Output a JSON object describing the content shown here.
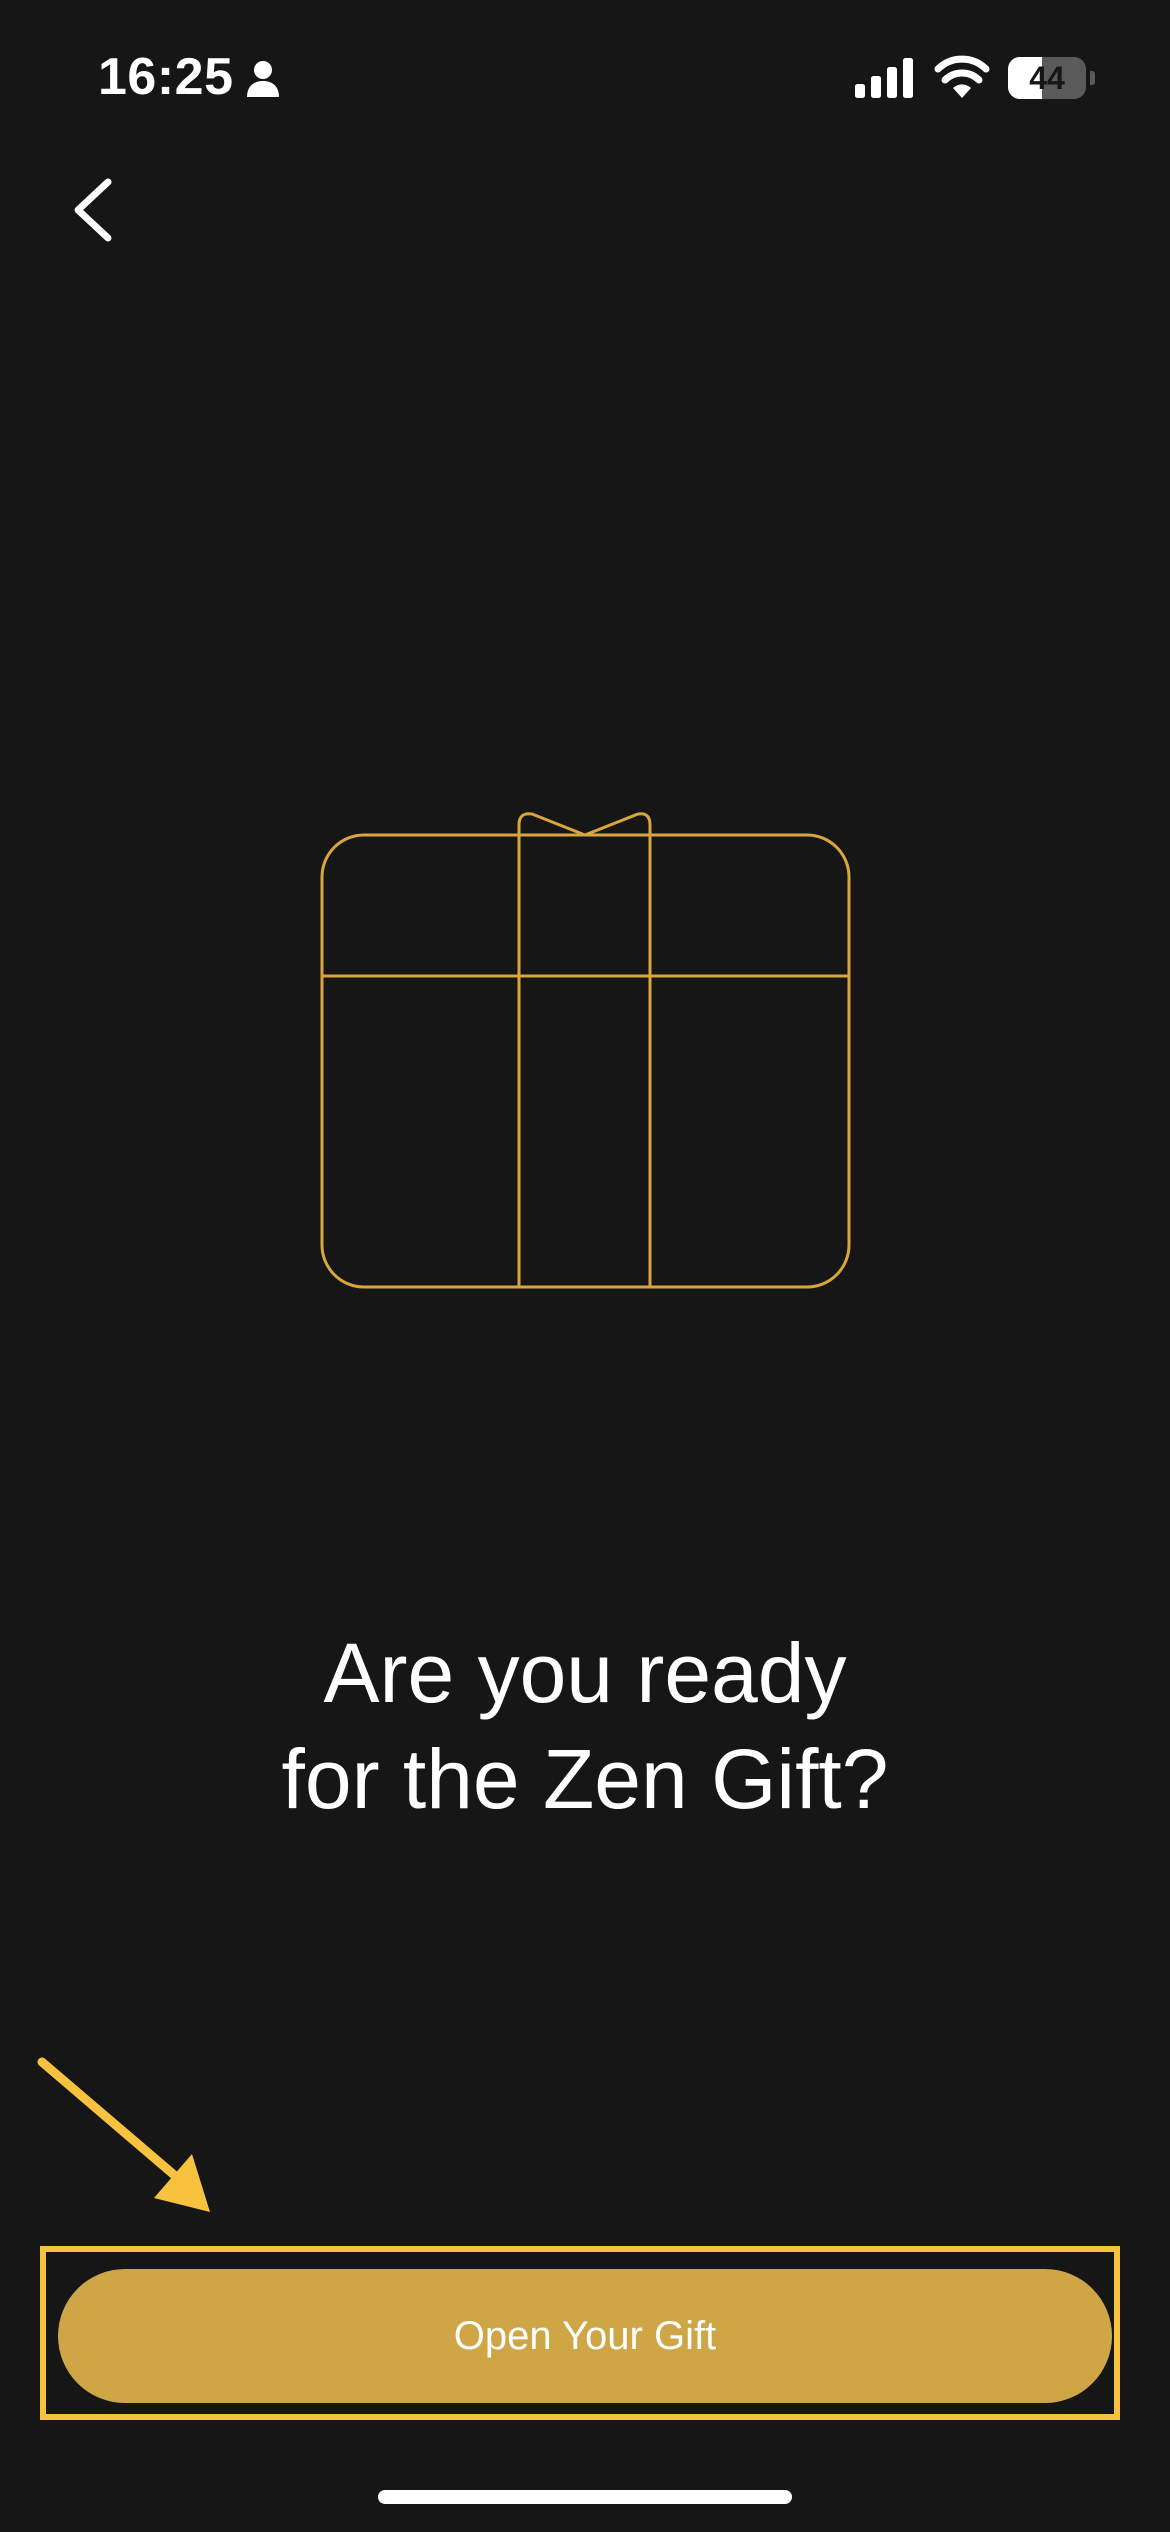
{
  "status_bar": {
    "time": "16:25",
    "battery_level": "44",
    "battery_fraction": 0.44,
    "icons": [
      "person-icon",
      "signal-icon",
      "wifi-icon",
      "battery-icon"
    ]
  },
  "nav": {
    "back_icon": "chevron-left-icon"
  },
  "illustration": {
    "icon": "gift-icon",
    "stroke_color": "#d8a63d"
  },
  "headline": {
    "line1": "Are you ready",
    "line2": "for the Zen Gift?"
  },
  "cta": {
    "label": "Open Your Gift",
    "background_color": "#cea646",
    "highlight_color": "#f7c33f"
  },
  "colors": {
    "background": "#161616",
    "text": "#ffffff"
  }
}
